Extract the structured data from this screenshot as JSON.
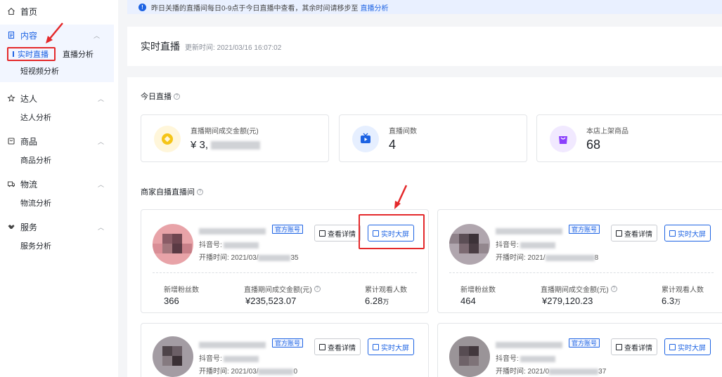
{
  "sidebar": {
    "home": "首页",
    "content": {
      "label": "内容",
      "items": [
        "实时直播",
        "直播分析",
        "短视频分析"
      ]
    },
    "talent": {
      "label": "达人",
      "items": [
        "达人分析"
      ]
    },
    "goods": {
      "label": "商品",
      "items": [
        "商品分析"
      ]
    },
    "logistics": {
      "label": "物流",
      "items": [
        "物流分析"
      ]
    },
    "service": {
      "label": "服务",
      "items": [
        "服务分析"
      ]
    }
  },
  "notice": {
    "text": "昨日关播的直播间每日0-9点于今日直播中查看，其余时间请移步至",
    "link": "直播分析"
  },
  "header": {
    "title": "实时直播",
    "updated": "更新时间: 2021/03/16 16:07:02"
  },
  "today": {
    "title": "今日直播",
    "stats": [
      {
        "label": "直播期间成交金额(元)",
        "value": "¥ 3,",
        "icon": "coin-icon",
        "color": "#f5c518"
      },
      {
        "label": "直播间数",
        "value": "4",
        "icon": "tv-icon",
        "color": "#1d63e3"
      },
      {
        "label": "本店上架商品",
        "value": "68",
        "icon": "bag-icon",
        "color": "#8a3ffc"
      }
    ]
  },
  "rooms_title": "商家自播直播间",
  "rooms": [
    {
      "tag": "官方账号",
      "douyin": "抖音号:",
      "start": "开播时间:  2021/03/",
      "start_tail": "35",
      "detail": "查看详情",
      "screen": "实时大屏",
      "fans_label": "新增粉丝数",
      "fans": "366",
      "gmv_label": "直播期间成交金额(元)",
      "gmv": "¥235,523.07",
      "viewers_label": "累计观看人数",
      "viewers": "6.28",
      "viewers_unit": "万"
    },
    {
      "tag": "官方账号",
      "douyin": "抖音号:",
      "start": "开播时间:  2021/",
      "start_tail": "8",
      "detail": "查看详情",
      "screen": "实时大屏",
      "fans_label": "新增粉丝数",
      "fans": "464",
      "gmv_label": "直播期间成交金额(元)",
      "gmv": "¥279,120.23",
      "viewers_label": "累计观看人数",
      "viewers": "6.3",
      "viewers_unit": "万"
    },
    {
      "tag": "官方账号",
      "douyin": "抖音号:",
      "start": "开播时间:  2021/03/",
      "start_tail": "0",
      "detail": "查看详情",
      "screen": "实时大屏"
    },
    {
      "tag": "官方账号",
      "douyin": "抖音号:",
      "start": "开播时间:  2021/0",
      "start_tail": "37",
      "detail": "查看详情",
      "screen": "实时大屏"
    }
  ],
  "colors": {
    "accent": "#1d63e3",
    "highlight": "#e4292b"
  }
}
